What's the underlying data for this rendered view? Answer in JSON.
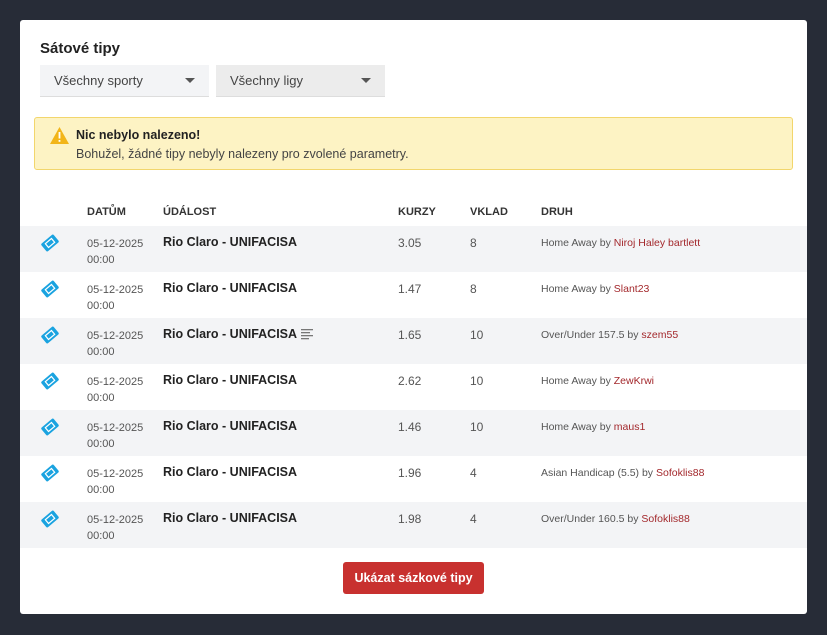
{
  "title": "Sátové tipy",
  "filters": {
    "sport": "Všechny sporty",
    "league": "Všechny ligy"
  },
  "alert": {
    "title": "Nic nebylo nalezeno!",
    "message": "Bohužel, žádné tipy nebyly nalezeny pro zvolené parametry."
  },
  "columns": {
    "date": "DATŮM",
    "event": "ÚDÁLOST",
    "odds": "KURZY",
    "stake": "VKLAD",
    "kind": "DRUH"
  },
  "rows": [
    {
      "date": "05-12-2025",
      "time": "00:00",
      "event": "Rio Claro - UNIFACISA",
      "odds": "3.05",
      "stake": "8",
      "kind": "Home Away by",
      "user": "Niroj Haley bartlett",
      "note": false
    },
    {
      "date": "05-12-2025",
      "time": "00:00",
      "event": "Rio Claro - UNIFACISA",
      "odds": "1.47",
      "stake": "8",
      "kind": "Home Away by",
      "user": "Slant23",
      "note": false
    },
    {
      "date": "05-12-2025",
      "time": "00:00",
      "event": "Rio Claro - UNIFACISA",
      "odds": "1.65",
      "stake": "10",
      "kind": "Over/Under 157.5 by",
      "user": "szem55",
      "note": true
    },
    {
      "date": "05-12-2025",
      "time": "00:00",
      "event": "Rio Claro - UNIFACISA",
      "odds": "2.62",
      "stake": "10",
      "kind": "Home Away by",
      "user": "ZewKrwi",
      "note": false
    },
    {
      "date": "05-12-2025",
      "time": "00:00",
      "event": "Rio Claro - UNIFACISA",
      "odds": "1.46",
      "stake": "10",
      "kind": "Home Away by",
      "user": "maus1",
      "note": false
    },
    {
      "date": "05-12-2025",
      "time": "00:00",
      "event": "Rio Claro - UNIFACISA",
      "odds": "1.96",
      "stake": "4",
      "kind": "Asian Handicap (5.5) by",
      "user": "Sofoklis88",
      "note": false
    },
    {
      "date": "05-12-2025",
      "time": "00:00",
      "event": "Rio Claro - UNIFACISA",
      "odds": "1.98",
      "stake": "4",
      "kind": "Over/Under 160.5 by",
      "user": "Sofoklis88",
      "note": false
    }
  ],
  "button": "Ukázat sázkové tipy",
  "colors": {
    "accent": "#c8312f",
    "ticket": "#1aa3e0",
    "link": "#a3282c"
  }
}
